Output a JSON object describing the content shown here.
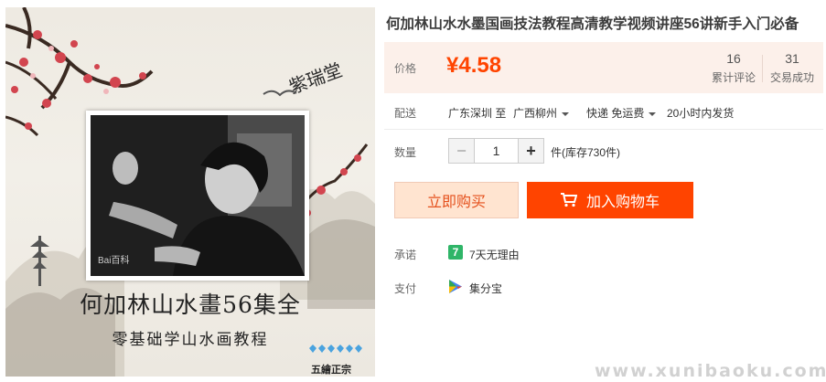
{
  "cover": {
    "title": "何加林山水畫56集全",
    "subtitle": "零基础学山水画教程",
    "seal": "五繪正宗",
    "calligraphy": "紫瑞堂",
    "photo_watermark": "Bai百科"
  },
  "product": {
    "title": "何加林山水水墨国画技法教程高清教学视频讲座56讲新手入门必备",
    "price_label": "价格",
    "price": "¥4.58",
    "reviews_count": "16",
    "reviews_label": "累计评论",
    "trades_count": "31",
    "trades_label": "交易成功"
  },
  "delivery": {
    "label": "配送",
    "origin": "广东深圳 至",
    "destination": "广西柳州",
    "shipping": "快递 免运费",
    "dispatch": "20小时内发货"
  },
  "quantity": {
    "label": "数量",
    "minus": "−",
    "value": "1",
    "plus": "+",
    "stock": "件(库存730件)"
  },
  "actions": {
    "buy_now": "立即购买",
    "add_to_cart": "加入购物车"
  },
  "promise": {
    "label": "承诺",
    "icon_text": "7",
    "text": "7天无理由"
  },
  "payment": {
    "label": "支付",
    "text": "集分宝"
  },
  "watermark": "www.xunibaoku.com",
  "colors": {
    "accent": "#ff4400",
    "price_bg": "#fcf0ea",
    "buy_bg": "#ffe4d0",
    "promise_green": "#2fb568"
  }
}
